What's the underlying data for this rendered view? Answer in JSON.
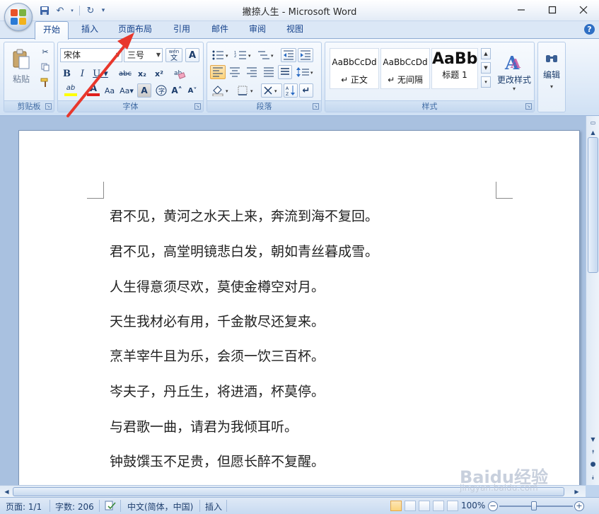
{
  "window": {
    "title": "撇捺人生 - Microsoft Word"
  },
  "tabs": [
    "开始",
    "插入",
    "页面布局",
    "引用",
    "邮件",
    "审阅",
    "视图"
  ],
  "ribbon": {
    "clipboard": {
      "paste_label": "粘贴",
      "group_label": "剪贴板"
    },
    "font": {
      "font_name": "宋体",
      "font_size": "三号",
      "wen_label": "wén",
      "group_label": "字体"
    },
    "paragraph": {
      "group_label": "段落"
    },
    "styles": {
      "items": [
        {
          "sample": "AaBbCcDd",
          "name": "↵ 正文"
        },
        {
          "sample": "AaBbCcDd",
          "name": "↵ 无间隔"
        },
        {
          "sample": "AaBb",
          "name": "标题 1"
        }
      ],
      "change_styles_label": "更改样式",
      "group_label": "样式"
    },
    "editing": {
      "label": "编辑"
    }
  },
  "document": {
    "lines": [
      "君不见，黄河之水天上来，奔流到海不复回。",
      "君不见，高堂明镜悲白发，朝如青丝暮成雪。",
      "人生得意须尽欢，莫使金樽空对月。",
      "天生我材必有用，千金散尽还复来。",
      "烹羊宰牛且为乐，会须一饮三百杯。",
      "岑夫子，丹丘生，将进酒，杯莫停。",
      "与君歌一曲，请君为我倾耳听。",
      "钟鼓馔玉不足贵，但愿长醉不复醒。"
    ]
  },
  "status": {
    "page": "页面: 1/1",
    "words": "字数: 206",
    "language": "中文(简体，中国)",
    "mode": "插入",
    "zoom": "100%"
  },
  "watermark": {
    "logo": "Baidu经验",
    "url": "jingyan.baidu.com"
  },
  "colors": {
    "annotation_arrow": "#e8372c",
    "ribbon_text": "#15428b"
  }
}
